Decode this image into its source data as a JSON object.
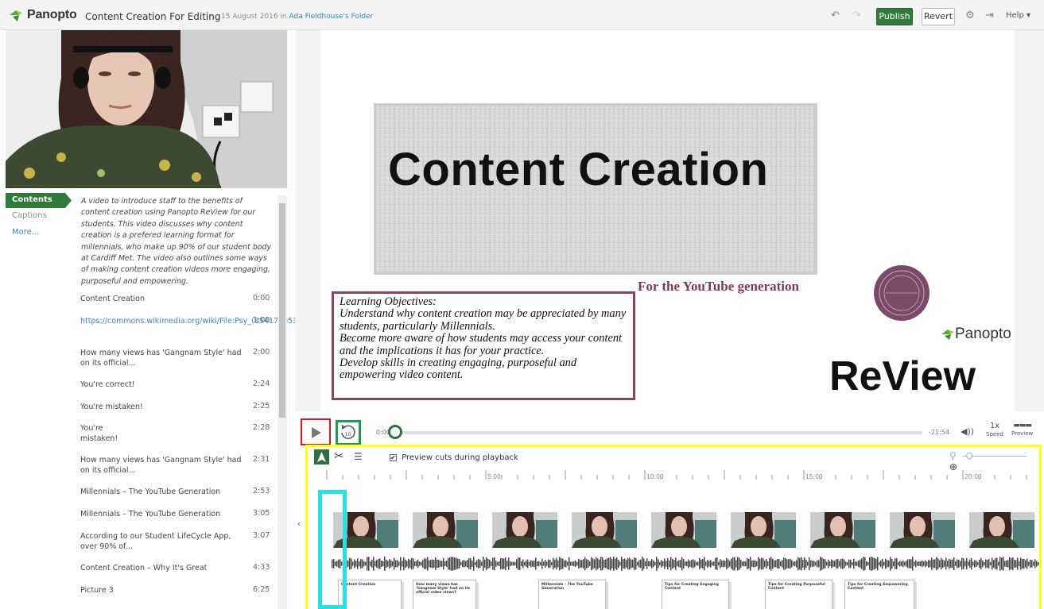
{
  "header": {
    "brand": "Panopto",
    "session_title": "Content Creation For Editing",
    "date_prefix": "15 August 2016 in",
    "folder_link": "Ada Fieldhouse's Folder",
    "publish_label": "Publish",
    "revert_label": "Revert",
    "help_label": "Help ▾"
  },
  "sidebar": {
    "tabs": [
      {
        "label": "Contents"
      },
      {
        "label": "Captions"
      },
      {
        "label": "More..."
      }
    ],
    "description": "A video to introduce staff to the benefits of content creation using Panopto ReView for our students. This video discusses why content creation is a prefered learning format for millennials, who make up 90% of our student body at Cardiff Met. The video also outlines some ways of making content creation videos more engaging, purposeful and empowering.",
    "toc": [
      {
        "title": "Content Creation",
        "time": "0:00"
      },
      {
        "title": "https://commons.wikimedia.org/wiki/File:Psy_(8541720534...",
        "time": "1:00"
      },
      {
        "title": "How many views has 'Gangnam Style' had on its official...",
        "time": "2:00"
      },
      {
        "title": "You're correct!",
        "time": "2:24"
      },
      {
        "title": "You're mistaken!",
        "time": "2:25"
      },
      {
        "title": "You're\nmistaken!",
        "time": "2:28"
      },
      {
        "title": "How many views has 'Gangnam Style' had on its official...",
        "time": "2:31"
      },
      {
        "title": "Millennials – The YouTube Generation",
        "time": "2:53"
      },
      {
        "title": "Millennials – The YouTube Generation",
        "time": "3:05"
      },
      {
        "title": "According to our Student LifeCycle App, over 90% of...",
        "time": "3:07"
      },
      {
        "title": "Content Creation – Why It's Great",
        "time": "4:33"
      },
      {
        "title": "Picture 3",
        "time": "6:25"
      }
    ]
  },
  "slide": {
    "title": "Content Creation",
    "subtitle": "For the YouTube generation",
    "objectives_heading": "Learning Objectives:",
    "objectives": [
      "Understand why content creation may be appreciated by many students, particularly Millennials.",
      "Become more aware of how students may access your content and the implications it has for your practice.",
      "Develop skills in creating engaging, purposeful and empowering video content."
    ],
    "panopto_logo_text": "Panopto",
    "review_logo_text": "ReView"
  },
  "player": {
    "current_time": "0:00",
    "remaining_time": "-21:54",
    "speed": "1x",
    "speed_label": "Speed",
    "preview_label": "Preview",
    "progress": 0.0
  },
  "editor": {
    "preview_cuts_label": "Preview cuts during playback",
    "preview_cuts_checked": true,
    "timeline_ticks": [
      "5:00",
      "10:00",
      "15:00",
      "20:00"
    ],
    "slide_thumbs": [
      "Content Creation",
      "How many views has 'Gangnam Style' had on its official video views?",
      "Millennials – The YouTube Generation",
      "Tips for Creating Engaging Content",
      "Tips for Creating Purposeful Content",
      "Tips for Creating Empowering Content"
    ]
  },
  "colors": {
    "publish_green": "#2f7a3c",
    "slide_accent": "#8a4565",
    "play_highlight": "#e0141b",
    "rewind_highlight": "#17a053",
    "editor_highlight": "#ffff1f",
    "playhead_highlight": "#29e0e2",
    "link_blue": "#3a82c4"
  }
}
